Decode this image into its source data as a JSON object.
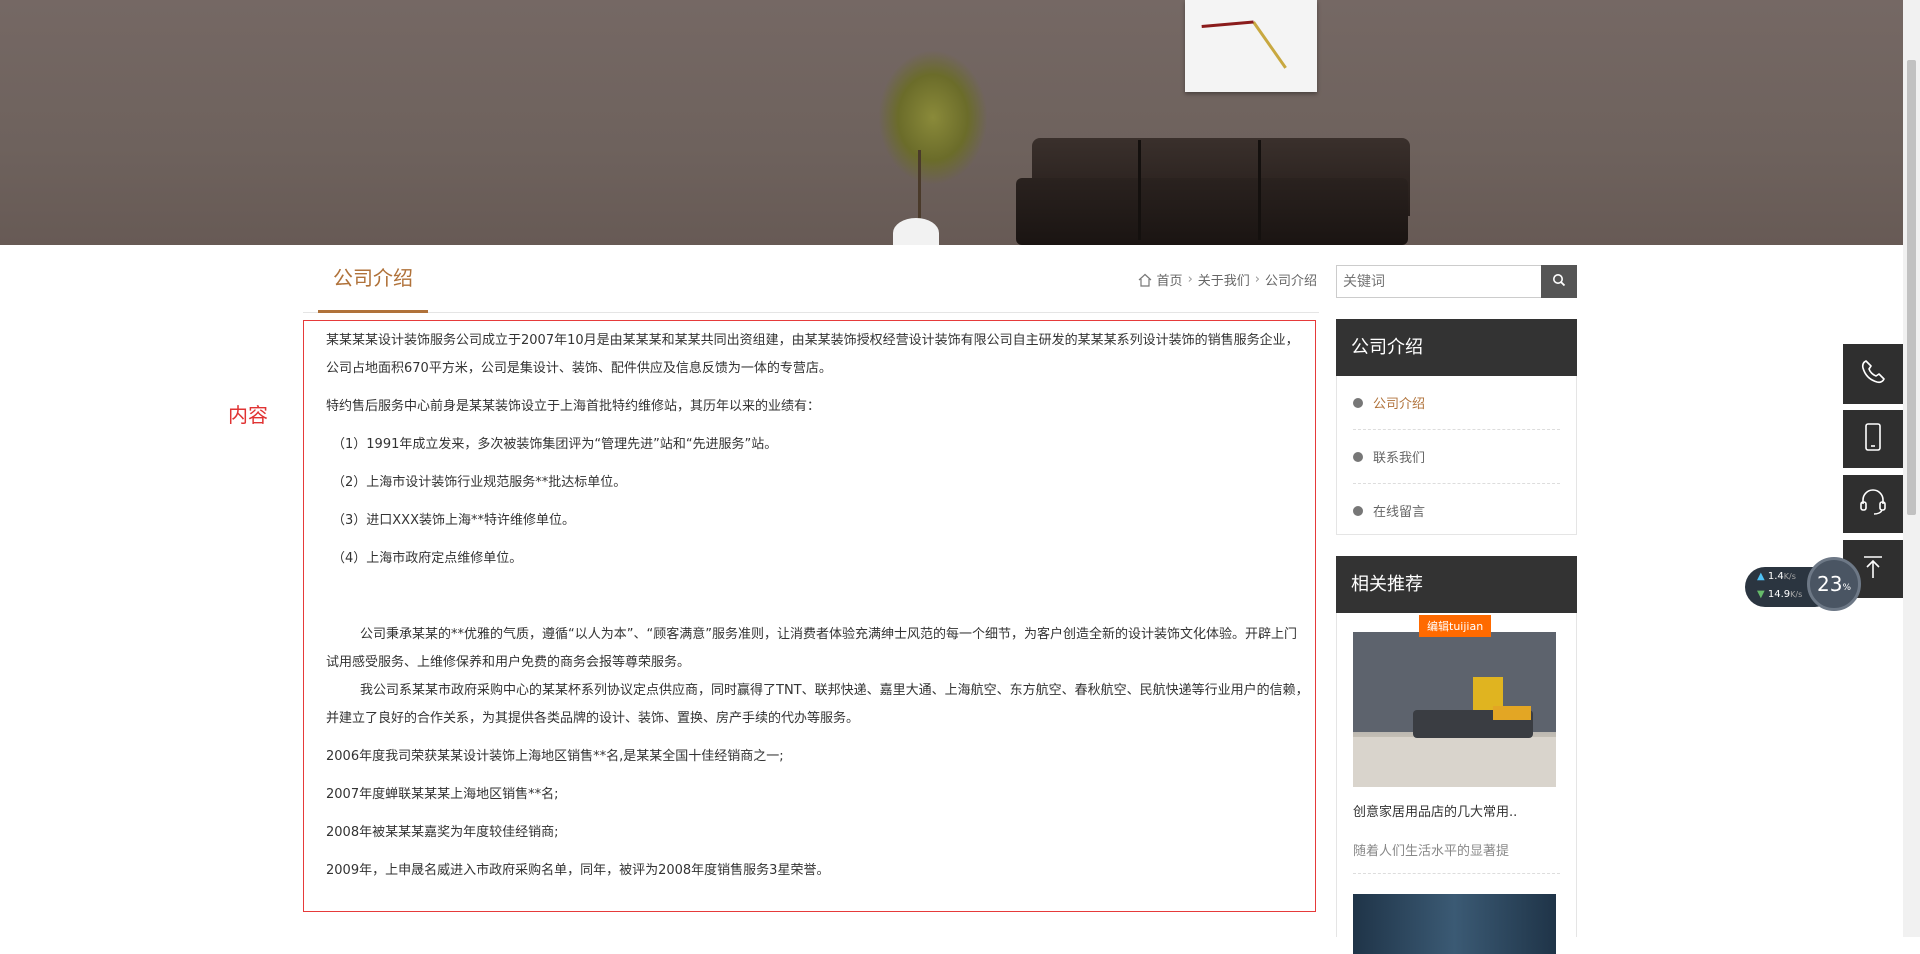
{
  "page_title": "公司介绍",
  "breadcrumb": {
    "home": "首页",
    "about": "关于我们",
    "current": "公司介绍"
  },
  "annotation": "内容",
  "content": {
    "paragraphs": [
      "某某某某设计装饰服务公司成立于2007年10月是由某某某和某某共同出资组建，由某某装饰授权经营设计装饰有限公司自主研发的某某某系列设计装饰的销售服务企业，公司占地面积670平方米，公司是集设计、装饰、配件供应及信息反馈为一体的专营店。",
      "特约售后服务中心前身是某某装饰设立于上海首批特约维修站，其历年以来的业绩有：",
      "（1）1991年成立发来，多次被装饰集团评为“管理先进”站和“先进服务”站。",
      "（2）上海市设计装饰行业规范服务**批达标单位。",
      "（3）进口XXX装饰上海**特许维修单位。",
      "（4）上海市政府定点维修单位。",
      "公司秉承某某的**优雅的气质，遵循“以人为本”、“顾客满意”服务准则，让消费者体验充满绅士风范的每一个细节，为客户创造全新的设计装饰文化体验。开辟上门试用感受服务、上维修保养和用户免费的商务会报等尊荣服务。",
      "我公司系某某市政府采购中心的某某杯系列协议定点供应商，同时赢得了TNT、联邦快递、嘉里大通、上海航空、东方航空、春秋航空、民航快递等行业用户的信赖，并建立了良好的合作关系，为其提供各类品牌的设计、装饰、置换、房产手续的代办等服务。",
      "2006年度我司荣获某某设计装饰上海地区销售**名,是某某全国十佳经销商之一;",
      "2007年度蝉联某某某上海地区销售**名;",
      "2008年被某某某嘉奖为年度较佳经销商;",
      "2009年，上申晟名威进入市政府采购名单，同年，被评为2008年度销售服务3星荣誉。"
    ]
  },
  "search": {
    "placeholder": "关键词"
  },
  "sidebar": {
    "nav_title": "公司介绍",
    "nav_items": [
      "公司介绍",
      "联系我们",
      "在线留言"
    ],
    "rec_title": "相关推荐",
    "rec_tag": "编辑tuijian",
    "rec_item_title": "创意家居用品店的几大常用..",
    "rec_item_desc": "随着人们生活水平的显著提"
  },
  "speed_widget": {
    "up": "1.4",
    "down": "14.9",
    "unit": "K/s",
    "percent": "23",
    "pct_sign": "%"
  },
  "colors": {
    "accent": "#b0723a",
    "annotation": "#e03333",
    "dark": "#333333",
    "tag": "#ff6a00"
  }
}
